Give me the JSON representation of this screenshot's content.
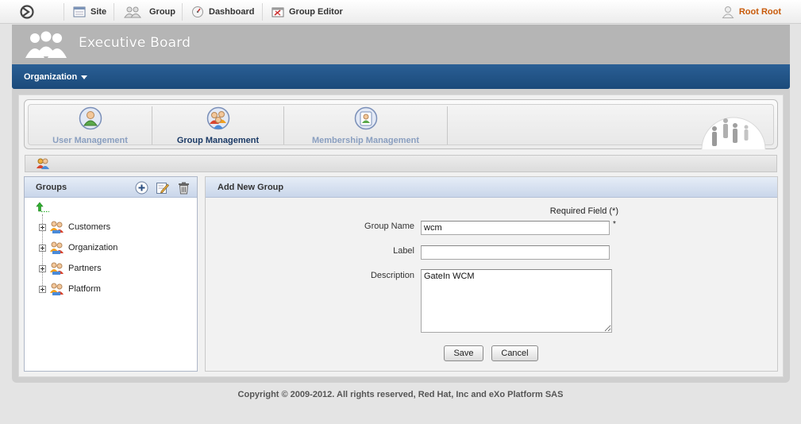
{
  "topbar": {
    "nav": [
      {
        "label": "Site",
        "icon": "site-icon"
      },
      {
        "label": "Group",
        "icon": "group-icon"
      },
      {
        "label": "Dashboard",
        "icon": "dashboard-icon"
      },
      {
        "label": "Group Editor",
        "icon": "group-editor-icon"
      }
    ],
    "user": "Root Root"
  },
  "header": {
    "title": "Executive Board"
  },
  "navbar": {
    "menu_label": "Organization"
  },
  "tabs": [
    {
      "label": "User Management",
      "active": false
    },
    {
      "label": "Group Management",
      "active": true
    },
    {
      "label": "Membership Management",
      "active": false
    }
  ],
  "groups_panel": {
    "title": "Groups",
    "items": [
      "Customers",
      "Organization",
      "Partners",
      "Platform"
    ]
  },
  "form": {
    "title": "Add New Group",
    "required_note": "Required Field (*)",
    "required_mark": "*",
    "fields": {
      "group_name": {
        "label": "Group Name",
        "value": "wcm"
      },
      "label": {
        "label": "Label",
        "value": ""
      },
      "description": {
        "label": "Description",
        "value": "GateIn WCM"
      }
    },
    "save_label": "Save",
    "cancel_label": "Cancel"
  },
  "footer": "Copyright © 2009-2012. All rights reserved, Red Hat, Inc and eXo Platform SAS",
  "colors": {
    "navbar": "#1f4f80",
    "user_link": "#c85a0a",
    "active_tab": "#1b3a66",
    "inactive_tab": "#8a9fc0"
  }
}
